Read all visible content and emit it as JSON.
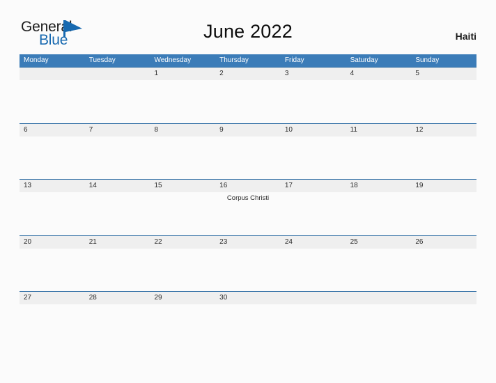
{
  "brand": {
    "word_one": "General",
    "word_two": "Blue",
    "flag_icon": "blue-triangle-flag-icon",
    "color_dark": "#1c1c1c",
    "color_blue": "#1769b0"
  },
  "header": {
    "title": "June 2022",
    "country": "Haiti"
  },
  "theme": {
    "header_blue": "#3b7cb8",
    "row_line_blue": "#2e6da4",
    "band_gray": "#efefef",
    "page_background": "#fbfbfb"
  },
  "calendar": {
    "weekdays": [
      "Monday",
      "Tuesday",
      "Wednesday",
      "Thursday",
      "Friday",
      "Saturday",
      "Sunday"
    ],
    "weeks": [
      {
        "days": [
          {
            "num": "",
            "event": ""
          },
          {
            "num": "",
            "event": ""
          },
          {
            "num": "1",
            "event": ""
          },
          {
            "num": "2",
            "event": ""
          },
          {
            "num": "3",
            "event": ""
          },
          {
            "num": "4",
            "event": ""
          },
          {
            "num": "5",
            "event": ""
          }
        ]
      },
      {
        "days": [
          {
            "num": "6",
            "event": ""
          },
          {
            "num": "7",
            "event": ""
          },
          {
            "num": "8",
            "event": ""
          },
          {
            "num": "9",
            "event": ""
          },
          {
            "num": "10",
            "event": ""
          },
          {
            "num": "11",
            "event": ""
          },
          {
            "num": "12",
            "event": ""
          }
        ]
      },
      {
        "days": [
          {
            "num": "13",
            "event": ""
          },
          {
            "num": "14",
            "event": ""
          },
          {
            "num": "15",
            "event": ""
          },
          {
            "num": "16",
            "event": "Corpus Christi"
          },
          {
            "num": "17",
            "event": ""
          },
          {
            "num": "18",
            "event": ""
          },
          {
            "num": "19",
            "event": ""
          }
        ]
      },
      {
        "days": [
          {
            "num": "20",
            "event": ""
          },
          {
            "num": "21",
            "event": ""
          },
          {
            "num": "22",
            "event": ""
          },
          {
            "num": "23",
            "event": ""
          },
          {
            "num": "24",
            "event": ""
          },
          {
            "num": "25",
            "event": ""
          },
          {
            "num": "26",
            "event": ""
          }
        ]
      },
      {
        "days": [
          {
            "num": "27",
            "event": ""
          },
          {
            "num": "28",
            "event": ""
          },
          {
            "num": "29",
            "event": ""
          },
          {
            "num": "30",
            "event": ""
          },
          {
            "num": "",
            "event": ""
          },
          {
            "num": "",
            "event": ""
          },
          {
            "num": "",
            "event": ""
          }
        ]
      }
    ]
  }
}
